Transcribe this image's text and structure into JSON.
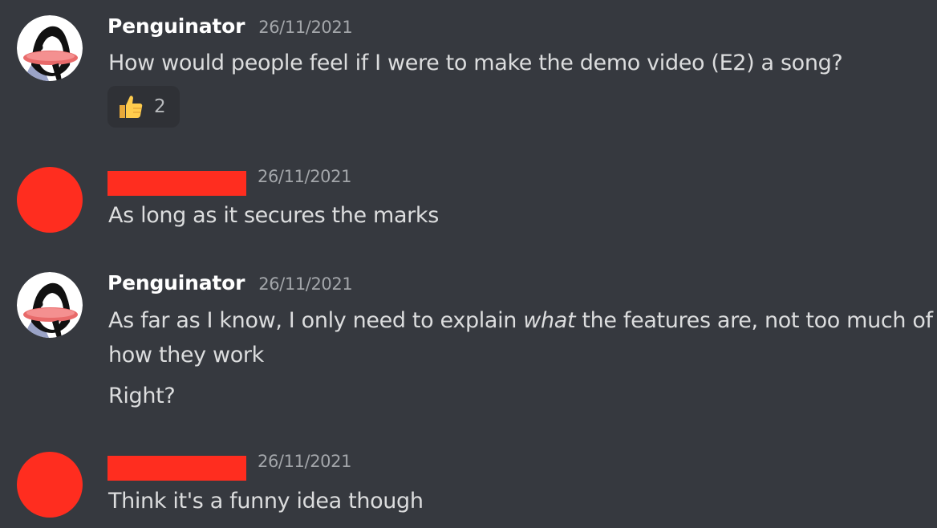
{
  "colors": {
    "background": "#36393f",
    "username": "#ffffff",
    "text": "#dcddde",
    "timestamp": "#a3a6aa",
    "redaction": "#ff2d1f",
    "reaction_bg": "#2f3136"
  },
  "messages": [
    {
      "author": "Penguinator",
      "avatar": "penguin-avatar",
      "timestamp": "26/11/2021",
      "lines": [
        "How would people feel if I were to make the demo video (E2) a song?"
      ],
      "reaction": {
        "emoji": "thumbs-up-icon",
        "count": "2"
      }
    },
    {
      "author": "",
      "avatar": "redacted-avatar",
      "timestamp": "26/11/2021",
      "lines": [
        "As long as it secures the marks"
      ]
    },
    {
      "author": "Penguinator",
      "avatar": "penguin-avatar",
      "timestamp": "26/11/2021",
      "lines": [
        "As far as I know, I only need to explain",
        "what",
        "the features are, not too much of",
        "how they work",
        "Right?"
      ]
    },
    {
      "author": "",
      "avatar": "redacted-avatar",
      "timestamp": "26/11/2021",
      "lines": [
        "Think it's a funny idea though"
      ]
    }
  ]
}
